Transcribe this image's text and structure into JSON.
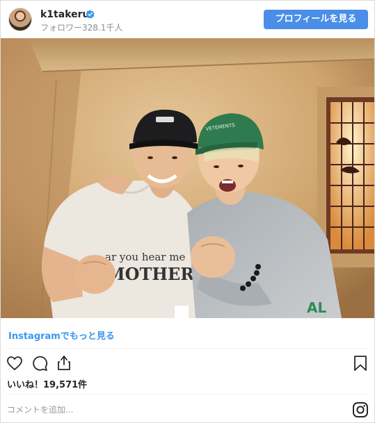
{
  "header": {
    "username": "k1takeru",
    "followers": "フォロワー328.1千人",
    "profile_button": "プロフィールを見る"
  },
  "photo": {
    "shirt_text": "ar you hear me MOTHER?"
  },
  "more_link": "Instagramでもっと見る",
  "likes": "いいね！19,571件",
  "comment": {
    "placeholder": "コメントを追加..."
  },
  "colors": {
    "accent": "#3897f0",
    "button": "#4a8ee8",
    "muted": "#8e8e8e",
    "border": "#dbdbdb"
  },
  "icons": [
    "verified-badge-icon",
    "heart-icon",
    "comment-icon",
    "share-icon",
    "bookmark-icon",
    "instagram-logo-icon"
  ]
}
